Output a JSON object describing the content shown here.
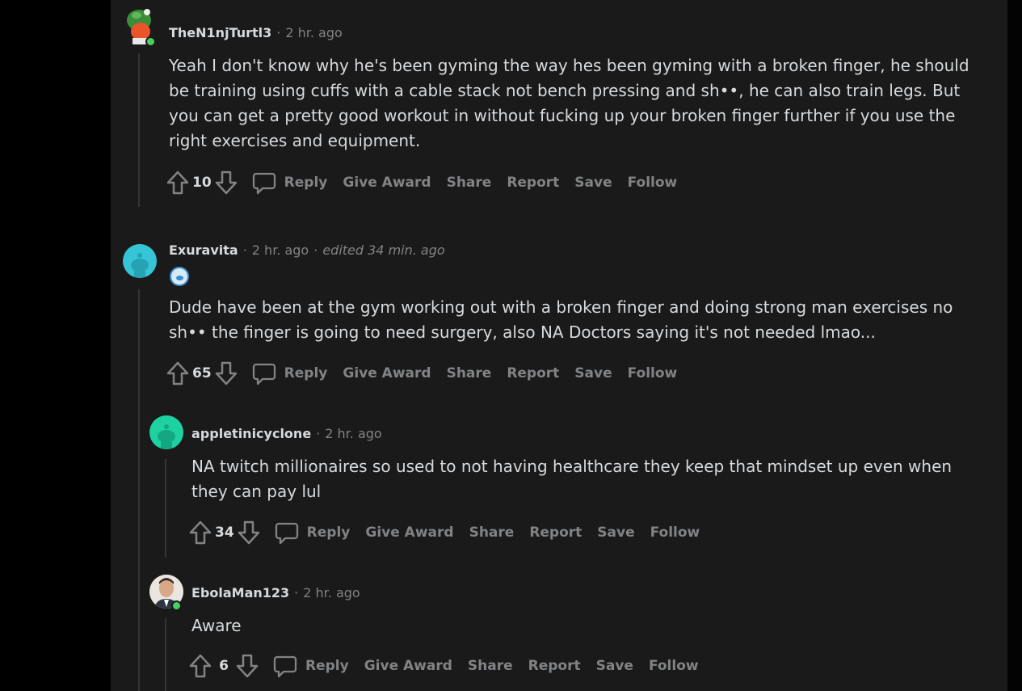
{
  "comments": [
    {
      "author": "TheN1njTurtl3",
      "time": "2 hr. ago",
      "edited": "",
      "body": "Yeah I don't know why he's been gyming the way hes been gyming with a broken finger, he should be training using cuffs with a cable stack not bench pressing and sh••, he can also train legs. But you can get a pretty good workout in without fucking up your broken finger further if you use the right exercises and equipment.",
      "score": "10"
    },
    {
      "author": "Exuravita",
      "time": "2 hr. ago",
      "edited": "edited 34 min. ago",
      "body": "Dude have been at the gym working out with a broken finger and doing strong man exercises no sh•• the finger is going to need surgery, also NA Doctors saying it's not needed lmao...",
      "score": "65"
    },
    {
      "author": "appletinicyclone",
      "time": "2 hr. ago",
      "edited": "",
      "body": "NA twitch millionaires so used to not having healthcare they keep that mindset up even when they can pay lul",
      "score": "34"
    },
    {
      "author": "EbolaMan123",
      "time": "2 hr. ago",
      "edited": "",
      "body": "Aware",
      "score": "6"
    }
  ],
  "actions": {
    "reply": "Reply",
    "give_award": "Give Award",
    "share": "Share",
    "report": "Report",
    "save": "Save",
    "follow": "Follow"
  },
  "separator": "·",
  "colors": {
    "background": "#1a1a1b",
    "page_edge": "#000000",
    "text": "#d7dadc",
    "muted": "#818384",
    "online": "#46d160",
    "snoo_cyan": "#36c5d6",
    "snoo_teal": "#1dd1a1"
  },
  "icons": {
    "upvote": "arrow-up-icon",
    "downvote": "arrow-down-icon",
    "reply": "speech-bubble-icon"
  }
}
